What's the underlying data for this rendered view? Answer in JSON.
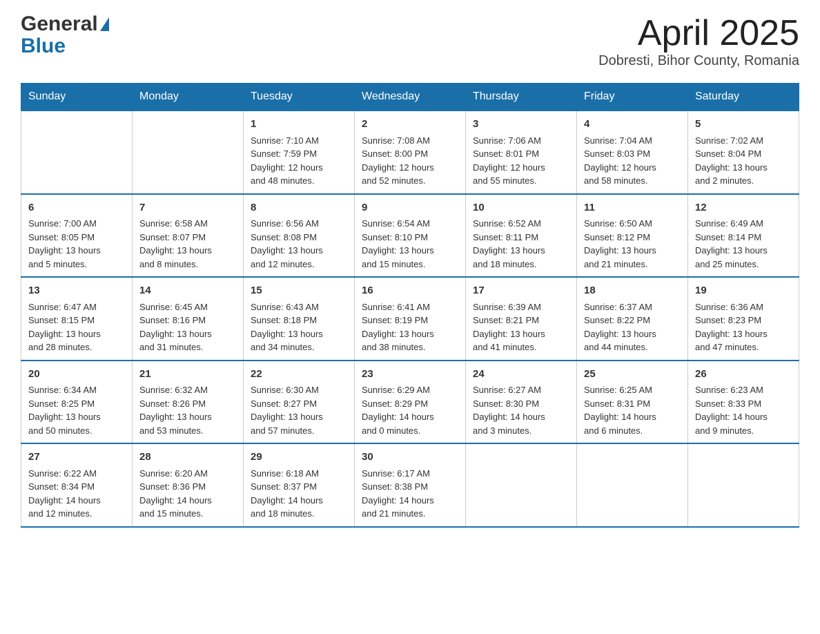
{
  "header": {
    "logo_general": "General",
    "logo_blue": "Blue",
    "title": "April 2025",
    "subtitle": "Dobresti, Bihor County, Romania"
  },
  "days_of_week": [
    "Sunday",
    "Monday",
    "Tuesday",
    "Wednesday",
    "Thursday",
    "Friday",
    "Saturday"
  ],
  "weeks": [
    [
      {
        "day": "",
        "content": ""
      },
      {
        "day": "",
        "content": ""
      },
      {
        "day": "1",
        "content": "Sunrise: 7:10 AM\nSunset: 7:59 PM\nDaylight: 12 hours\nand 48 minutes."
      },
      {
        "day": "2",
        "content": "Sunrise: 7:08 AM\nSunset: 8:00 PM\nDaylight: 12 hours\nand 52 minutes."
      },
      {
        "day": "3",
        "content": "Sunrise: 7:06 AM\nSunset: 8:01 PM\nDaylight: 12 hours\nand 55 minutes."
      },
      {
        "day": "4",
        "content": "Sunrise: 7:04 AM\nSunset: 8:03 PM\nDaylight: 12 hours\nand 58 minutes."
      },
      {
        "day": "5",
        "content": "Sunrise: 7:02 AM\nSunset: 8:04 PM\nDaylight: 13 hours\nand 2 minutes."
      }
    ],
    [
      {
        "day": "6",
        "content": "Sunrise: 7:00 AM\nSunset: 8:05 PM\nDaylight: 13 hours\nand 5 minutes."
      },
      {
        "day": "7",
        "content": "Sunrise: 6:58 AM\nSunset: 8:07 PM\nDaylight: 13 hours\nand 8 minutes."
      },
      {
        "day": "8",
        "content": "Sunrise: 6:56 AM\nSunset: 8:08 PM\nDaylight: 13 hours\nand 12 minutes."
      },
      {
        "day": "9",
        "content": "Sunrise: 6:54 AM\nSunset: 8:10 PM\nDaylight: 13 hours\nand 15 minutes."
      },
      {
        "day": "10",
        "content": "Sunrise: 6:52 AM\nSunset: 8:11 PM\nDaylight: 13 hours\nand 18 minutes."
      },
      {
        "day": "11",
        "content": "Sunrise: 6:50 AM\nSunset: 8:12 PM\nDaylight: 13 hours\nand 21 minutes."
      },
      {
        "day": "12",
        "content": "Sunrise: 6:49 AM\nSunset: 8:14 PM\nDaylight: 13 hours\nand 25 minutes."
      }
    ],
    [
      {
        "day": "13",
        "content": "Sunrise: 6:47 AM\nSunset: 8:15 PM\nDaylight: 13 hours\nand 28 minutes."
      },
      {
        "day": "14",
        "content": "Sunrise: 6:45 AM\nSunset: 8:16 PM\nDaylight: 13 hours\nand 31 minutes."
      },
      {
        "day": "15",
        "content": "Sunrise: 6:43 AM\nSunset: 8:18 PM\nDaylight: 13 hours\nand 34 minutes."
      },
      {
        "day": "16",
        "content": "Sunrise: 6:41 AM\nSunset: 8:19 PM\nDaylight: 13 hours\nand 38 minutes."
      },
      {
        "day": "17",
        "content": "Sunrise: 6:39 AM\nSunset: 8:21 PM\nDaylight: 13 hours\nand 41 minutes."
      },
      {
        "day": "18",
        "content": "Sunrise: 6:37 AM\nSunset: 8:22 PM\nDaylight: 13 hours\nand 44 minutes."
      },
      {
        "day": "19",
        "content": "Sunrise: 6:36 AM\nSunset: 8:23 PM\nDaylight: 13 hours\nand 47 minutes."
      }
    ],
    [
      {
        "day": "20",
        "content": "Sunrise: 6:34 AM\nSunset: 8:25 PM\nDaylight: 13 hours\nand 50 minutes."
      },
      {
        "day": "21",
        "content": "Sunrise: 6:32 AM\nSunset: 8:26 PM\nDaylight: 13 hours\nand 53 minutes."
      },
      {
        "day": "22",
        "content": "Sunrise: 6:30 AM\nSunset: 8:27 PM\nDaylight: 13 hours\nand 57 minutes."
      },
      {
        "day": "23",
        "content": "Sunrise: 6:29 AM\nSunset: 8:29 PM\nDaylight: 14 hours\nand 0 minutes."
      },
      {
        "day": "24",
        "content": "Sunrise: 6:27 AM\nSunset: 8:30 PM\nDaylight: 14 hours\nand 3 minutes."
      },
      {
        "day": "25",
        "content": "Sunrise: 6:25 AM\nSunset: 8:31 PM\nDaylight: 14 hours\nand 6 minutes."
      },
      {
        "day": "26",
        "content": "Sunrise: 6:23 AM\nSunset: 8:33 PM\nDaylight: 14 hours\nand 9 minutes."
      }
    ],
    [
      {
        "day": "27",
        "content": "Sunrise: 6:22 AM\nSunset: 8:34 PM\nDaylight: 14 hours\nand 12 minutes."
      },
      {
        "day": "28",
        "content": "Sunrise: 6:20 AM\nSunset: 8:36 PM\nDaylight: 14 hours\nand 15 minutes."
      },
      {
        "day": "29",
        "content": "Sunrise: 6:18 AM\nSunset: 8:37 PM\nDaylight: 14 hours\nand 18 minutes."
      },
      {
        "day": "30",
        "content": "Sunrise: 6:17 AM\nSunset: 8:38 PM\nDaylight: 14 hours\nand 21 minutes."
      },
      {
        "day": "",
        "content": ""
      },
      {
        "day": "",
        "content": ""
      },
      {
        "day": "",
        "content": ""
      }
    ]
  ]
}
